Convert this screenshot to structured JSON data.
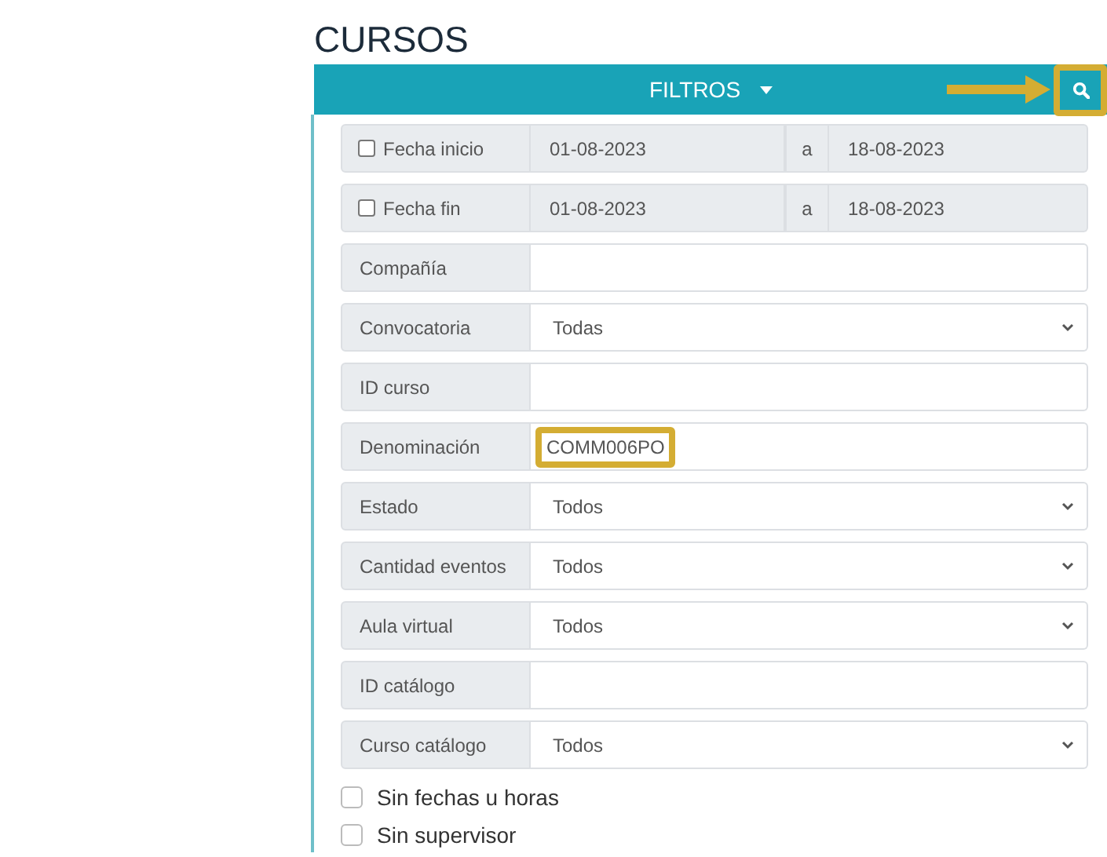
{
  "title": "CURSOS",
  "filter_bar": {
    "label": "FILTROS",
    "search_highlighted": true
  },
  "date_rows": [
    {
      "label": "Fecha inicio",
      "checked": false,
      "from": "01-08-2023",
      "separator": "a",
      "to": "18-08-2023"
    },
    {
      "label": "Fecha fin",
      "checked": false,
      "from": "01-08-2023",
      "separator": "a",
      "to": "18-08-2023"
    }
  ],
  "fields": [
    {
      "kind": "text",
      "label": "Compañía"
    },
    {
      "kind": "select",
      "label": "Convocatoria",
      "value": "Todas"
    },
    {
      "kind": "text",
      "label": "ID curso"
    },
    {
      "kind": "text",
      "label": "Denominación",
      "value": "COMM006PO",
      "highlighted": true
    },
    {
      "kind": "select",
      "label": "Estado",
      "value": "Todos"
    },
    {
      "kind": "select",
      "label": "Cantidad eventos",
      "value": "Todos"
    },
    {
      "kind": "select",
      "label": "Aula virtual",
      "value": "Todos"
    },
    {
      "kind": "text",
      "label": "ID catálogo"
    },
    {
      "kind": "select",
      "label": "Curso catálogo",
      "value": "Todos"
    }
  ],
  "checkboxes": [
    {
      "label": "Sin fechas u horas",
      "checked": false
    },
    {
      "label": "Sin supervisor",
      "checked": false
    }
  ]
}
